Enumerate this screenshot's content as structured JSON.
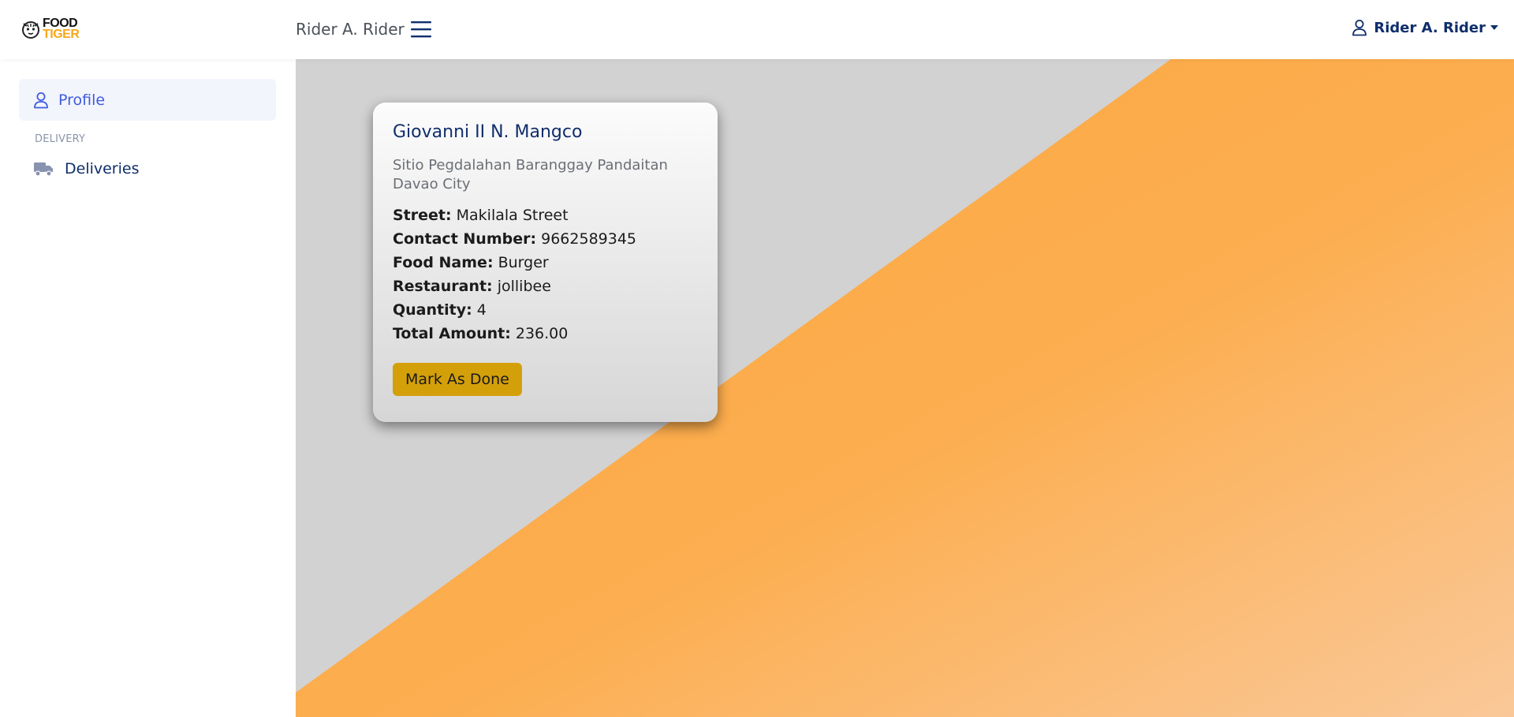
{
  "brand": {
    "food": "FOOD",
    "tiger": "TIGER",
    "logo_icon": "tiger-head-icon",
    "accent": "#f7a71b"
  },
  "header": {
    "title": "Rider A. Rider",
    "menu_icon": "hamburger-icon",
    "user_icon": "user-icon",
    "user_name": "Rider A. Rider",
    "dropdown_icon": "caret-down-icon"
  },
  "sidebar": {
    "profile": {
      "label": "Profile",
      "icon": "user-icon"
    },
    "section_delivery": "DELIVERY",
    "deliveries": {
      "label": "Deliveries",
      "icon": "truck-icon"
    }
  },
  "delivery_card": {
    "customer_name": "Giovanni II N. Mangco",
    "address": "Sitio Pegdalahan Baranggay Pandaitan Davao City",
    "fields": [
      {
        "label": "Street:",
        "value": "Makilala Street"
      },
      {
        "label": "Contact Number:",
        "value": "9662589345"
      },
      {
        "label": "Food Name:",
        "value": "Burger"
      },
      {
        "label": "Restaurant:",
        "value": "jollibee"
      },
      {
        "label": "Quantity:",
        "value": "4"
      },
      {
        "label": "Total Amount:",
        "value": "236.00"
      }
    ],
    "action_label": "Mark As Done"
  },
  "colors": {
    "primary": "#3f5ce0",
    "navy": "#0f2e6b",
    "orange": "#fbab45",
    "button": "#d4a00a",
    "gray_bg": "#d2d2d3"
  }
}
